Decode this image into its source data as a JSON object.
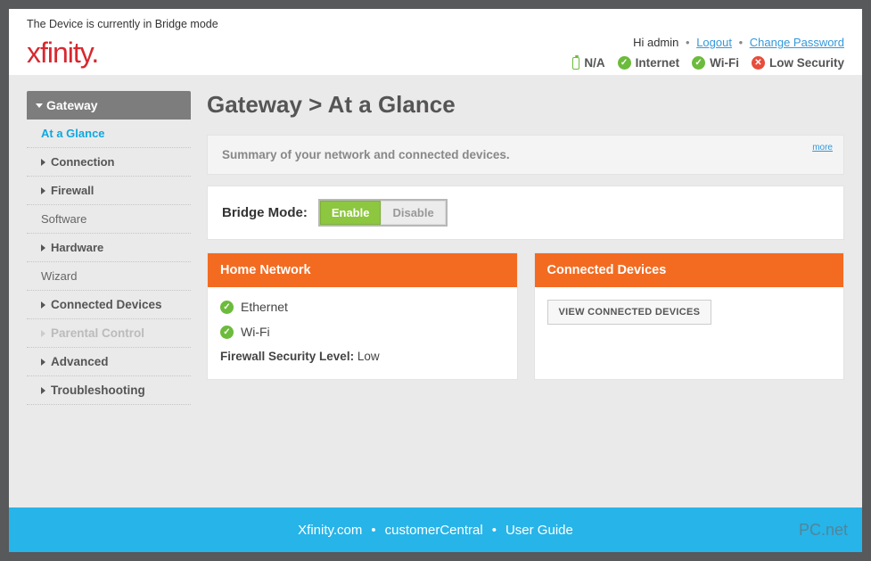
{
  "notice": "The Device is currently in Bridge mode",
  "logo": "xfinity.",
  "user": {
    "greeting": "Hi admin",
    "logout": "Logout",
    "change_pw": "Change Password"
  },
  "status": {
    "battery": "N/A",
    "internet": "Internet",
    "wifi": "Wi-Fi",
    "security": "Low Security"
  },
  "nav": {
    "gateway": "Gateway",
    "at_a_glance": "At a Glance",
    "connection": "Connection",
    "firewall": "Firewall",
    "software": "Software",
    "hardware": "Hardware",
    "wizard": "Wizard",
    "connected_devices": "Connected Devices",
    "parental": "Parental Control",
    "advanced": "Advanced",
    "troubleshooting": "Troubleshooting"
  },
  "title": "Gateway > At a Glance",
  "summary": {
    "text": "Summary of your network and connected devices.",
    "more": "more"
  },
  "bridge": {
    "label": "Bridge Mode:",
    "enable": "Enable",
    "disable": "Disable"
  },
  "home_network": {
    "title": "Home Network",
    "ethernet": "Ethernet",
    "wifi": "Wi-Fi",
    "firewall_label": "Firewall Security Level:",
    "firewall_value": "Low"
  },
  "connected_devices": {
    "title": "Connected Devices",
    "view_btn": "VIEW CONNECTED DEVICES"
  },
  "footer": {
    "link1": "Xfinity.com",
    "link2": "customerCentral",
    "link3": "User Guide",
    "brand": "PC.net"
  }
}
